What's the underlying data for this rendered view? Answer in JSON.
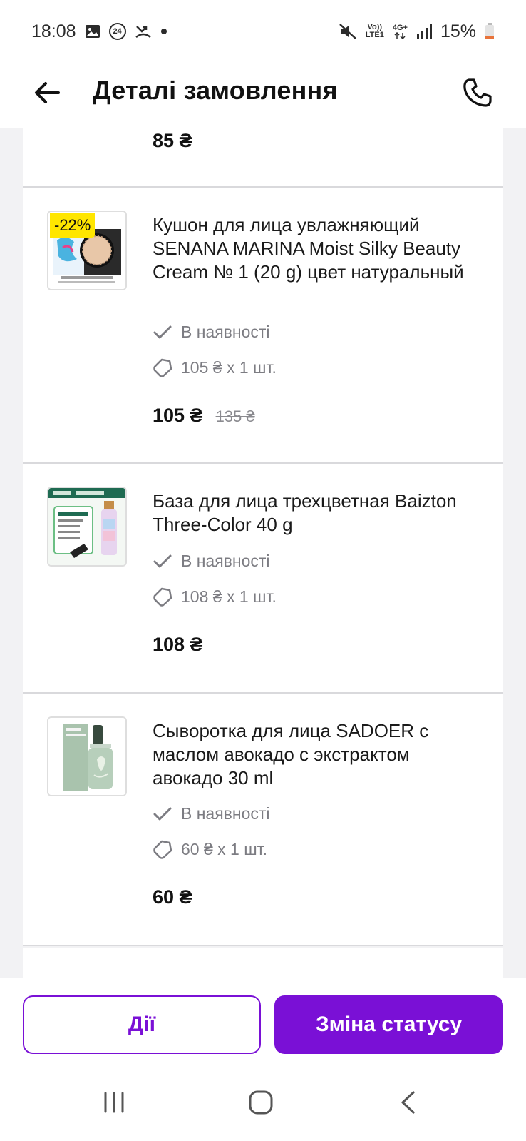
{
  "status_bar": {
    "time": "18:08",
    "notif_badge": "24",
    "network_top": "Vo))",
    "network_bottom": "LTE1",
    "network_type": "4G+",
    "battery": "15%"
  },
  "header": {
    "title": "Деталі замовлення"
  },
  "items": [
    {
      "price": "85 ₴"
    },
    {
      "discount": "-22%",
      "name": "Кушон для лица увлажняющий SENANA MARINA Moist Silky Beauty Cream  № 1 (20 g) цвет натуральный",
      "availability": "В наявності",
      "unit_price": "105 ₴ x 1 шт.",
      "price": "105 ₴",
      "old_price": "135 ₴"
    },
    {
      "name": "База для лица трехцветная Baizton Three-Color 40 g",
      "availability": "В наявності",
      "unit_price": "108 ₴ x 1 шт.",
      "price": "108 ₴"
    },
    {
      "name": "Сыворотка для лица SADOER с маслом авокадо с экстрактом авокадо 30 ml",
      "availability": "В наявності",
      "unit_price": "60 ₴ x 1 шт.",
      "price": "60 ₴"
    }
  ],
  "actions": {
    "actions_label": "Дії",
    "change_status_label": "Зміна статусу"
  },
  "colors": {
    "accent": "#7a10d6",
    "discount_badge": "#ffe600"
  },
  "icons": {
    "back": "arrow-left-icon",
    "phone": "phone-icon",
    "check": "check-icon",
    "tag": "price-tag-icon"
  }
}
